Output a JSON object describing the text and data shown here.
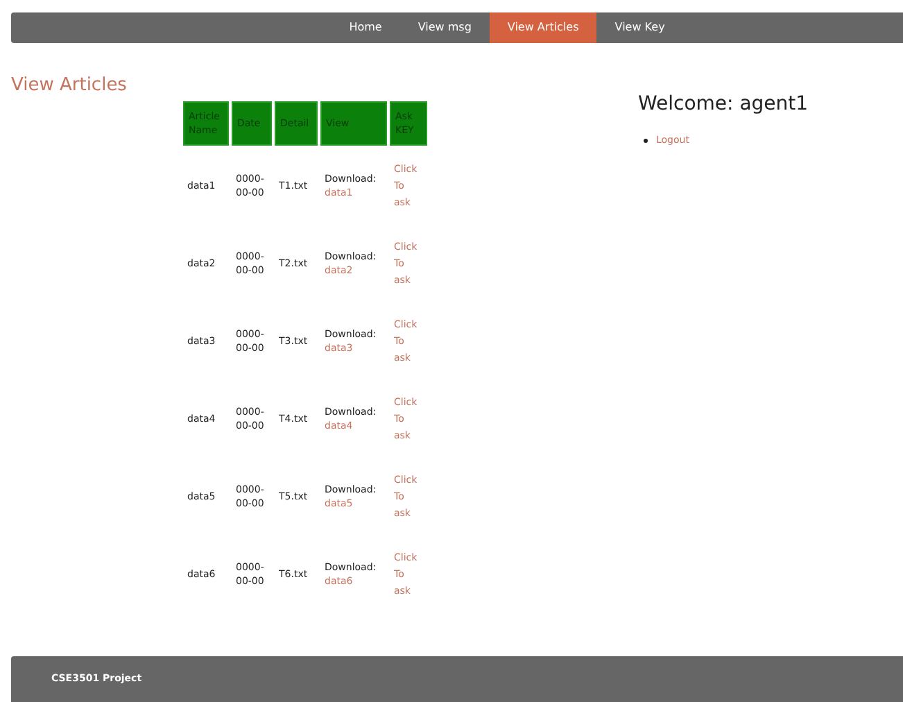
{
  "nav": [
    {
      "label": "Home",
      "selected": false
    },
    {
      "label": "View msg",
      "selected": false
    },
    {
      "label": "View Articles",
      "selected": true
    },
    {
      "label": "View Key",
      "selected": false
    }
  ],
  "heading": "View Articles",
  "table": {
    "columns": [
      "Article Name",
      "Date",
      "Detail",
      "View",
      "Ask KEY"
    ],
    "rows": [
      {
        "name": "data1",
        "date": "0000-00-00",
        "detail": "T1.txt",
        "view_label": "Download:",
        "view_link": "data1",
        "ask": "Click To ask"
      },
      {
        "name": "data2",
        "date": "0000-00-00",
        "detail": "T2.txt",
        "view_label": "Download:",
        "view_link": "data2",
        "ask": "Click To ask"
      },
      {
        "name": "data3",
        "date": "0000-00-00",
        "detail": "T3.txt",
        "view_label": "Download:",
        "view_link": "data3",
        "ask": "Click To ask"
      },
      {
        "name": "data4",
        "date": "0000-00-00",
        "detail": "T4.txt",
        "view_label": "Download:",
        "view_link": "data4",
        "ask": "Click To ask"
      },
      {
        "name": "data5",
        "date": "0000-00-00",
        "detail": "T5.txt",
        "view_label": "Download:",
        "view_link": "data5",
        "ask": "Click To ask"
      },
      {
        "name": "data6",
        "date": "0000-00-00",
        "detail": "T6.txt",
        "view_label": "Download:",
        "view_link": "data6",
        "ask": "Click To ask"
      }
    ]
  },
  "sidebar": {
    "welcome": "Welcome: agent1",
    "links": [
      "Logout"
    ]
  },
  "footer": "CSE3501 Project"
}
